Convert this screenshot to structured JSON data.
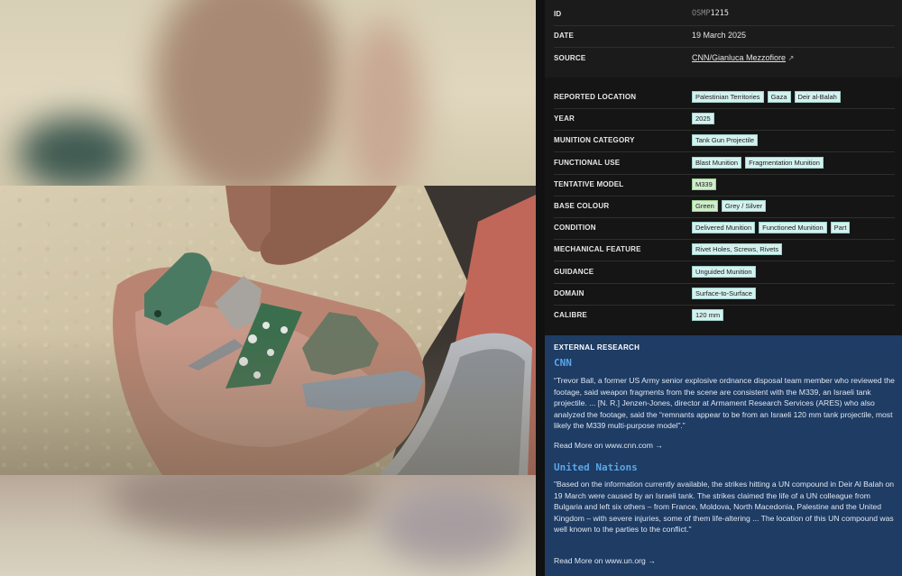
{
  "details": {
    "id": {
      "label": "ID",
      "prefix": "OSMP",
      "number": "1215"
    },
    "date": {
      "label": "DATE",
      "value": "19 March 2025"
    },
    "source": {
      "label": "SOURCE",
      "value": "CNN/Gianluca Mezzofiore",
      "icon": "external-link-icon",
      "arrow": "↗"
    }
  },
  "attributes": [
    {
      "label": "REPORTED LOCATION",
      "tags": [
        "Palestinian Territories",
        "Gaza",
        "Deir al-Balah"
      ]
    },
    {
      "label": "YEAR",
      "tags": [
        "2025"
      ]
    },
    {
      "label": "MUNITION CATEGORY",
      "tags": [
        "Tank Gun Projectile"
      ]
    },
    {
      "label": "FUNCTIONAL USE",
      "tags": [
        "Blast Munition",
        "Fragmentation Munition"
      ]
    },
    {
      "label": "TENTATIVE MODEL",
      "tags": [
        "M339"
      ]
    },
    {
      "label": "BASE COLOUR",
      "tags": [
        "Green",
        "Grey / Silver"
      ]
    },
    {
      "label": "CONDITION",
      "tags": [
        "Delivered Munition",
        "Functioned Munition",
        "Part"
      ]
    },
    {
      "label": "MECHANICAL FEATURE",
      "tags": [
        "Rivet Holes, Screws, Rivets"
      ]
    },
    {
      "label": "GUIDANCE",
      "tags": [
        "Unguided Munition"
      ]
    },
    {
      "label": "DOMAIN",
      "tags": [
        "Surface-to-Surface"
      ]
    },
    {
      "label": "CALIBRE",
      "tags": [
        "120 mm"
      ]
    }
  ],
  "research": {
    "heading": "EXTERNAL RESEARCH",
    "sources": [
      {
        "title": "CNN",
        "quote": "“Trevor Ball, a former US Army senior explosive ordnance disposal team member who reviewed the footage, said weapon fragments from the scene are consistent with the M339, an Israeli tank projectile. ... [N. R.] Jenzen-Jones, director at Armament Research Services (ARES) who also analyzed the footage, said the “remnants appear to be from an Israeli 120 mm tank projectile, most likely the M339 multi-purpose model”.”",
        "read_more": "Read More on www.cnn.com →"
      },
      {
        "title": "United Nations",
        "quote": "\"Based on the information currently available, the strikes hitting a UN compound in Deir Al Balah on 19 March were caused by an Israeli tank. The strikes claimed the life of a UN colleague from Bulgaria and left six others – from France, Moldova, North Macedonia, Palestine and the United Kingdom – with severe injuries, some of them life-altering ... The location of this UN compound was well known to the parties to the conflict.\"",
        "read_more": "Read More on www.un.org →"
      }
    ]
  },
  "colors": {
    "panel_bg": "#151515",
    "research_bg": "#1e3c64",
    "tag_bg": "#d3f2ef",
    "tag_green_bg": "#cfeecb",
    "source_title": "#5aa6e8"
  }
}
